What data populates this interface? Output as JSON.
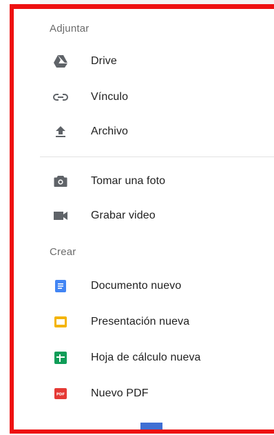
{
  "attach": {
    "header": "Adjuntar",
    "items": [
      {
        "label": "Drive",
        "icon": "drive-icon"
      },
      {
        "label": "Vínculo",
        "icon": "link-icon"
      },
      {
        "label": "Archivo",
        "icon": "upload-icon"
      },
      {
        "label": "Tomar una foto",
        "icon": "camera-icon"
      },
      {
        "label": "Grabar video",
        "icon": "video-icon"
      }
    ]
  },
  "create": {
    "header": "Crear",
    "items": [
      {
        "label": "Documento nuevo",
        "icon": "docs-icon",
        "color": "#4285f4"
      },
      {
        "label": "Presentación nueva",
        "icon": "slides-icon",
        "color": "#f4b400"
      },
      {
        "label": "Hoja de cálculo nueva",
        "icon": "sheets-icon",
        "color": "#0f9d58"
      },
      {
        "label": "Nuevo PDF",
        "icon": "pdf-icon",
        "color": "#e53935",
        "badge": "PDF"
      }
    ]
  },
  "colors": {
    "annotation_border": "#ee1111",
    "icon_gray": "#5f6368",
    "bottom_tab": "#3f6fd4"
  }
}
